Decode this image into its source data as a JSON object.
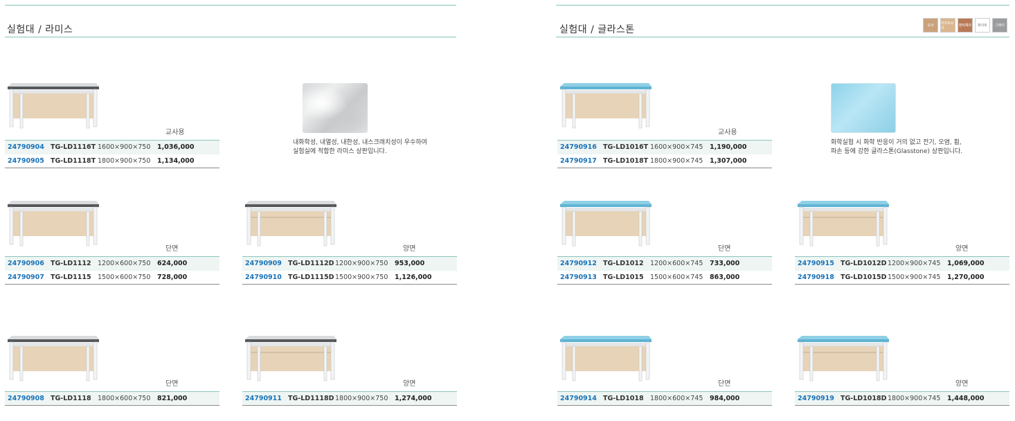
{
  "left": {
    "title": "실험대 / 라미스",
    "description": [
      "내화학성, 내열성, 내한성, 내스크래치성이 우수하여",
      "실험실에 적합한 라미스 상판입니다."
    ],
    "products": [
      {
        "usage": "교사용",
        "rows": [
          {
            "code": "24790904",
            "model": "TG-LD1116T",
            "size": "1600×900×750",
            "price": "1,036,000"
          },
          {
            "code": "24790905",
            "model": "TG-LD1118T",
            "size": "1800×900×750",
            "price": "1,134,000"
          }
        ]
      },
      {
        "usage": "단면",
        "rows": [
          {
            "code": "24790906",
            "model": "TG-LD1112",
            "size": "1200×600×750",
            "price": "624,000"
          },
          {
            "code": "24790907",
            "model": "TG-LD1115",
            "size": "1500×600×750",
            "price": "728,000"
          }
        ]
      },
      {
        "usage": "양면",
        "rows": [
          {
            "code": "24790909",
            "model": "TG-LD1112D",
            "size": "1200×900×750",
            "price": "953,000"
          },
          {
            "code": "24790910",
            "model": "TG-LD1115D",
            "size": "1500×900×750",
            "price": "1,126,000"
          }
        ]
      },
      {
        "usage": "단면",
        "rows": [
          {
            "code": "24790908",
            "model": "TG-LD1118",
            "size": "1800×600×750",
            "price": "821,000"
          }
        ]
      },
      {
        "usage": "양면",
        "rows": [
          {
            "code": "24790911",
            "model": "TG-LD1118D",
            "size": "1800×900×750",
            "price": "1,274,000"
          }
        ]
      }
    ]
  },
  "right": {
    "title": "실험대 / 글라스톤",
    "swatches": [
      {
        "label": "오크",
        "color": "#c9a27c"
      },
      {
        "label": "라이트오크",
        "color": "#dcb68e"
      },
      {
        "label": "엔틱체리",
        "color": "#b87a56"
      },
      {
        "label": "화이트",
        "color": "#ffffff"
      },
      {
        "label": "그레이",
        "color": "#9a9c9e"
      }
    ],
    "description": [
      "화학실험 시 화학 반응이 거의 없고 전기, 오염, 휨,",
      "파손 등에 강한 글라스톤(Glasstone) 상판입니다."
    ],
    "products": [
      {
        "usage": "교사용",
        "rows": [
          {
            "code": "24790916",
            "model": "TG-LD1016T",
            "size": "1600×900×745",
            "price": "1,190,000"
          },
          {
            "code": "24790917",
            "model": "TG-LD1018T",
            "size": "1800×900×745",
            "price": "1,307,000"
          }
        ]
      },
      {
        "usage": "단면",
        "rows": [
          {
            "code": "24790912",
            "model": "TG-LD1012",
            "size": "1200×600×745",
            "price": "733,000"
          },
          {
            "code": "24790913",
            "model": "TG-LD1015",
            "size": "1500×600×745",
            "price": "863,000"
          }
        ]
      },
      {
        "usage": "양면",
        "rows": [
          {
            "code": "24790915",
            "model": "TG-LD1012D",
            "size": "1200×900×745",
            "price": "1,069,000"
          },
          {
            "code": "24790918",
            "model": "TG-LD1015D",
            "size": "1500×900×745",
            "price": "1,270,000"
          }
        ]
      },
      {
        "usage": "단면",
        "rows": [
          {
            "code": "24790914",
            "model": "TG-LD1018",
            "size": "1800×600×745",
            "price": "984,000"
          }
        ]
      },
      {
        "usage": "양면",
        "rows": [
          {
            "code": "24790919",
            "model": "TG-LD1018D",
            "size": "1800×900×745",
            "price": "1,448,000"
          }
        ]
      }
    ]
  }
}
